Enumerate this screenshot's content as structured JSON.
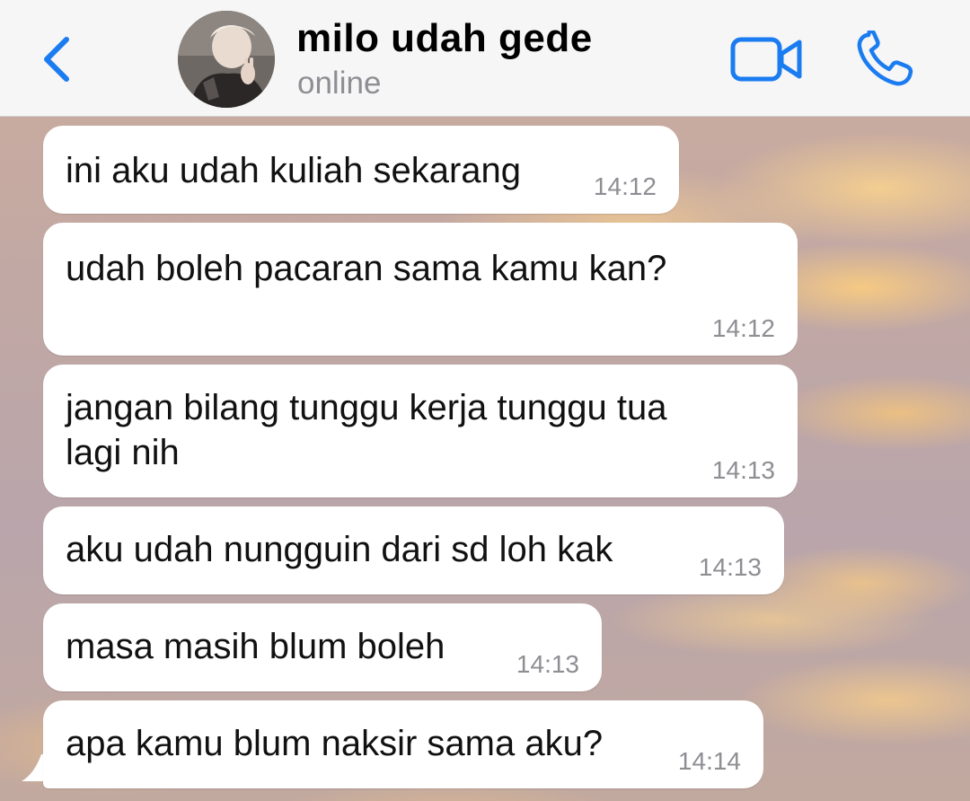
{
  "header": {
    "back_icon": "chevron-left-icon",
    "contact_name": "milo udah gede",
    "status": "online",
    "video_icon": "video-camera-icon",
    "call_icon": "phone-icon",
    "accent_color": "#1a7cf0"
  },
  "chat": {
    "messages": [
      {
        "text": "ini aku udah kuliah sekarang",
        "time": "14:12"
      },
      {
        "text": "udah boleh pacaran sama kamu kan?",
        "time": "14:12"
      },
      {
        "text_line1": "jangan bilang tunggu kerja tunggu tua",
        "text_line2": "lagi nih",
        "time": "14:13"
      },
      {
        "text": "aku udah nungguin dari sd loh kak",
        "time": "14:13"
      },
      {
        "text": "masa masih blum boleh",
        "time": "14:13"
      },
      {
        "text": "apa kamu blum naksir sama aku?",
        "time": "14:14"
      }
    ]
  }
}
